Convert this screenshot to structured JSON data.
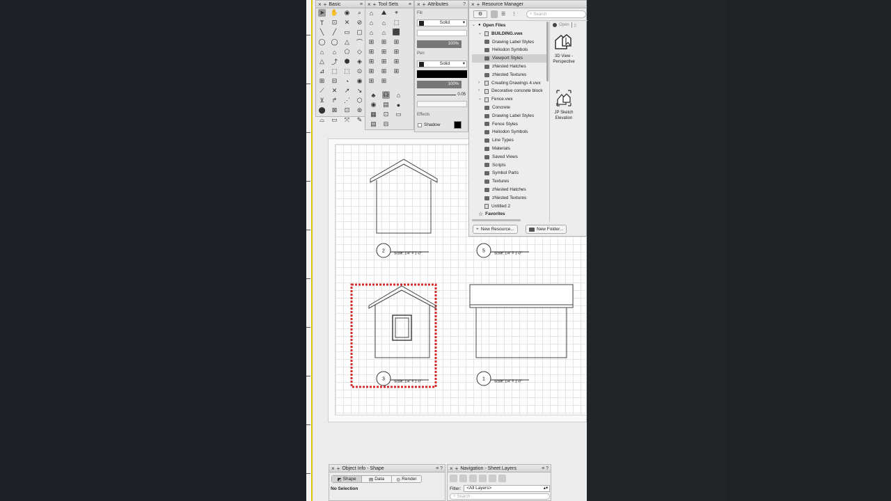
{
  "basic_palette": {
    "title": "Basic"
  },
  "toolsets_palette": {
    "title": "Tool Sets"
  },
  "attributes": {
    "title": "Attributes",
    "fill_label": "Fill",
    "fill_style": "Solid",
    "fill_opacity": "100%",
    "pen_label": "Pen",
    "pen_style": "Solid",
    "pen_opacity": "100%",
    "line_weight": "0.05",
    "effects_label": "Effects",
    "shadow_label": "Shadow"
  },
  "resource_manager": {
    "title": "Resource Manager",
    "search_placeholder": "Search",
    "open_tab": "Open",
    "tree": [
      {
        "label": "Open Files",
        "bold": true,
        "indent": 0,
        "type": "header"
      },
      {
        "label": "BUILDING.vwx",
        "bold": true,
        "indent": 1,
        "type": "file",
        "open": true
      },
      {
        "label": "Drawing Label Styles",
        "indent": 2,
        "type": "folder"
      },
      {
        "label": "Heliodon Symbols",
        "indent": 2,
        "type": "folder"
      },
      {
        "label": "Viewport Styles",
        "indent": 2,
        "type": "folder",
        "selected": true
      },
      {
        "label": "zNested Hatches",
        "indent": 2,
        "type": "folder"
      },
      {
        "label": "zNested Textures",
        "indent": 2,
        "type": "folder"
      },
      {
        "label": "Creating Drawings 4.vwx",
        "indent": 1,
        "type": "file",
        "closed": true
      },
      {
        "label": "Decorative concrete block",
        "indent": 1,
        "type": "file",
        "closed": true
      },
      {
        "label": "Fence.vwx",
        "indent": 1,
        "type": "file",
        "open": true
      },
      {
        "label": "Concrete",
        "indent": 2,
        "type": "folder"
      },
      {
        "label": "Drawing Label Styles",
        "indent": 2,
        "type": "folder"
      },
      {
        "label": "Fence Styles",
        "indent": 2,
        "type": "folder"
      },
      {
        "label": "Heliodon Symbols",
        "indent": 2,
        "type": "folder"
      },
      {
        "label": "Line Types",
        "indent": 2,
        "type": "folder"
      },
      {
        "label": "Materials",
        "indent": 2,
        "type": "folder"
      },
      {
        "label": "Saved Views",
        "indent": 2,
        "type": "folder"
      },
      {
        "label": "Scripts",
        "indent": 2,
        "type": "folder"
      },
      {
        "label": "Symbol Parts",
        "indent": 2,
        "type": "folder"
      },
      {
        "label": "Textures",
        "indent": 2,
        "type": "folder"
      },
      {
        "label": "zNested Hatches",
        "indent": 2,
        "type": "folder"
      },
      {
        "label": "zNested Textures",
        "indent": 2,
        "type": "folder"
      },
      {
        "label": "Untitled 2",
        "indent": 1,
        "type": "file"
      },
      {
        "label": "Favorites",
        "bold": true,
        "indent": 0,
        "type": "favorites"
      }
    ],
    "resources": [
      {
        "name": "3D View - Perspective"
      },
      {
        "name": "JP Sketch Elevation"
      }
    ],
    "new_resource_btn": "New Resource...",
    "new_folder_btn": "New Folder..."
  },
  "viewports": [
    {
      "number": "2",
      "scale": "Scale: 1/4\" = 1'-0\""
    },
    {
      "number": "5",
      "scale": "Scale: 1/4\" = 1'-0\""
    },
    {
      "number": "3",
      "scale": "Scale: 1/4\" = 1'-0\""
    },
    {
      "number": "1",
      "scale": "Scale: 1/4\" = 1'-0\""
    }
  ],
  "object_info": {
    "title": "Object Info - Shape",
    "tabs": [
      "Shape",
      "Data",
      "Render"
    ],
    "status": "No Selection"
  },
  "navigation": {
    "title": "Navigation - Sheet Layers",
    "filter_label": "Filter:",
    "filter_value": "<All Layers>",
    "search_placeholder": "Search"
  },
  "colors": {
    "selection": "#d22c2c",
    "accent_ruler": "#d8c700"
  }
}
